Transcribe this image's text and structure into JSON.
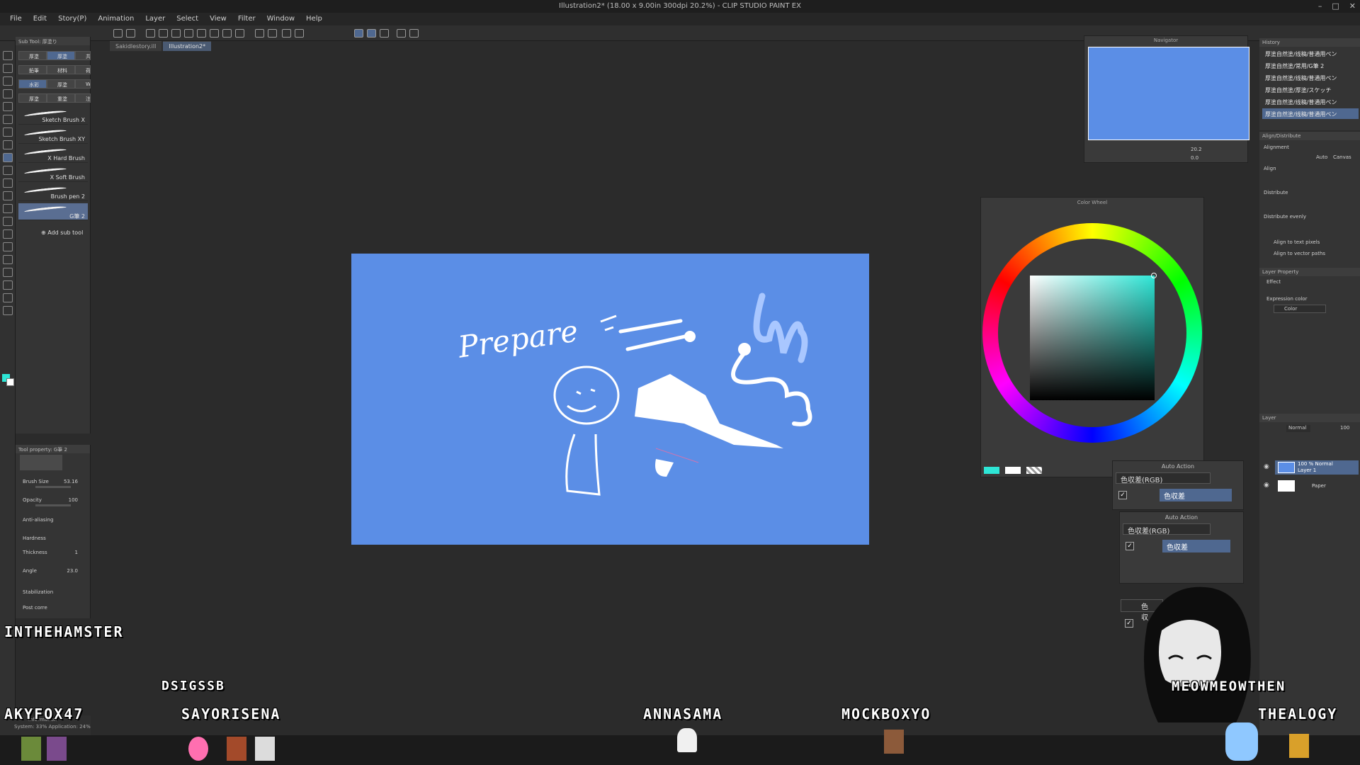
{
  "window": {
    "title": "Illustration2* (18.00 x 9.00in 300dpi 20.2%) - CLIP STUDIO PAINT EX"
  },
  "menu": [
    "File",
    "Edit",
    "Story(P)",
    "Animation",
    "Layer",
    "Select",
    "View",
    "Filter",
    "Window",
    "Help"
  ],
  "tabs": [
    {
      "label": "Sakidlestory.ill",
      "active": false
    },
    {
      "label": "Illustration2*",
      "active": true
    }
  ],
  "subtool": {
    "header": "Sub Tool: 厚塗り",
    "groups": [
      "厚塗",
      "厚塗",
      "共通",
      "鉛筆",
      "材料",
      "荷物",
      "水彩",
      "厚塗",
      "Wate",
      "厚塗",
      "重塗",
      "注意"
    ],
    "brushes": [
      "Sketch Brush X",
      "Sketch Brush XY",
      "X Hard Brush",
      "X Soft Brush",
      "Brush pen 2",
      "G筆 2"
    ],
    "add_label": "Add sub tool"
  },
  "toolprop": {
    "header": "Tool property: G筆 2",
    "brush_size_label": "Brush Size",
    "brush_size": "53.16",
    "opacity_label": "Opacity",
    "opacity": "100",
    "antialias_label": "Anti-aliasing",
    "hardness_label": "Hardness",
    "thickness_label": "Thickness",
    "thickness": "1",
    "angle_label": "Angle",
    "angle": "23.0",
    "stabilization_label": "Stabilization",
    "postcorrection_label": "Post corre"
  },
  "info": {
    "title": "Information",
    "line": "System: 33% Application: 24%"
  },
  "navigator": {
    "title": "Navigator",
    "zoom": "20.2",
    "angle": "0.0"
  },
  "colorwheel": {
    "title": "Color Wheel",
    "main_color": "#2ee6d6",
    "sub_color": "#ffffff"
  },
  "history": {
    "title": "History",
    "items": [
      "厚塗自然塗/线稿/普通用ペン",
      "厚塗自然塗/常用/G筆 2",
      "厚塗自然塗/线稿/普通用ペン",
      "厚塗自然塗/厚塗/スケッチ",
      "厚塗自然塗/线稿/普通用ペン",
      "厚塗自然塗/线稿/普通用ペン"
    ]
  },
  "align": {
    "title": "Align/Distribute",
    "alignment_label": "Alignment",
    "auto_label": "Auto",
    "canvas_label": "Canvas",
    "align_label": "Align",
    "distribute_label": "Distribute",
    "distribute_evenly_label": "Distribute evenly",
    "text_pixels_label": "Align to text pixels",
    "vector_paths_label": "Align to vector paths"
  },
  "layerprop": {
    "title": "Layer Property",
    "effect_label": "Effect",
    "expression_label": "Expression color",
    "expression_value": "Color"
  },
  "layers": {
    "title": "Layer",
    "blend": "Normal",
    "opacity": "100",
    "items": [
      {
        "name": "Layer 1",
        "meta": "100 % Normal",
        "selected": true
      },
      {
        "name": "Paper",
        "meta": "",
        "selected": false
      }
    ]
  },
  "autoaction": [
    {
      "title": "Auto Action",
      "set": "色収差(RGB)",
      "action": "色収差"
    },
    {
      "title": "Auto Action",
      "set": "色収差(RGB)",
      "action": "色収差"
    }
  ],
  "autoaction_partial": "色収",
  "canvas_text": "Prepare",
  "stream": {
    "names": [
      {
        "text": "INTHEHAMSTER"
      },
      {
        "text": "DSIGSSB"
      },
      {
        "text": "AKYFOX47"
      },
      {
        "text": "SAYORISENA"
      },
      {
        "text": "ANNASAMA"
      },
      {
        "text": "MOCKBOXYO"
      },
      {
        "text": "MEOWMEOWTHEN"
      },
      {
        "text": "THEALOGY"
      }
    ]
  },
  "colors": {
    "canvas_bg": "#5b8ee6",
    "selection": "#4f6890",
    "panel": "#343434"
  }
}
